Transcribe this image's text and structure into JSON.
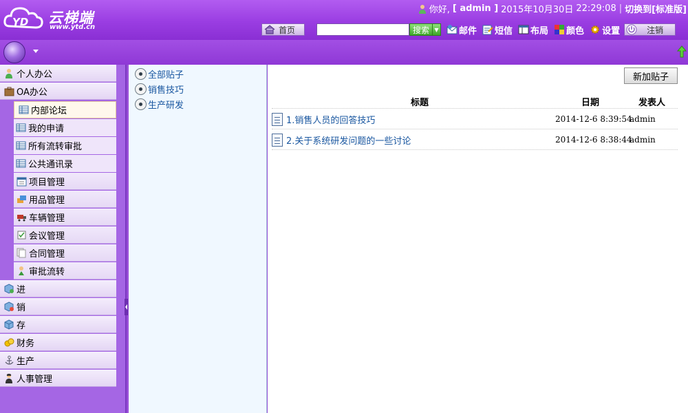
{
  "header": {
    "logo_text": "云梯端",
    "logo_url": "www.ytd.cn",
    "greeting": "你好,",
    "username": "[ admin ]",
    "date": "2015年10月30日",
    "time": "22:29:08",
    "switch_label": "切换到[标准版]"
  },
  "toolbar": {
    "home_label": "首页",
    "search_placeholder": "",
    "search_label": "搜索",
    "mail_label": "邮件",
    "sms_label": "短信",
    "layout_label": "布局",
    "color_label": "颜色",
    "settings_label": "设置",
    "logout_label": "注销"
  },
  "sidebar": {
    "items": [
      {
        "label": "个人办公",
        "icon": "person-icon"
      },
      {
        "label": "OA办公",
        "icon": "briefcase-icon"
      },
      {
        "label": "内部论坛",
        "icon": "grid-icon",
        "active": true
      },
      {
        "label": "我的申请",
        "icon": "grid-icon"
      },
      {
        "label": "所有流转审批",
        "icon": "grid-icon"
      },
      {
        "label": "公共通讯录",
        "icon": "grid-icon"
      },
      {
        "label": "项目管理",
        "icon": "calendar-icon"
      },
      {
        "label": "用品管理",
        "icon": "supplies-icon"
      },
      {
        "label": "车辆管理",
        "icon": "truck-icon"
      },
      {
        "label": "会议管理",
        "icon": "meeting-icon"
      },
      {
        "label": "合同管理",
        "icon": "pages-icon"
      },
      {
        "label": "审批流转",
        "icon": "approval-icon"
      },
      {
        "label": "进",
        "icon": "cube-in-icon"
      },
      {
        "label": "销",
        "icon": "cube-out-icon"
      },
      {
        "label": "存",
        "icon": "cube-icon"
      },
      {
        "label": "财务",
        "icon": "coins-icon"
      },
      {
        "label": "生产",
        "icon": "anchor-icon"
      },
      {
        "label": "人事管理",
        "icon": "staff-icon"
      }
    ]
  },
  "categories": [
    "全部贴子",
    "销售技巧",
    "生产研发"
  ],
  "main": {
    "new_post_label": "新加贴子",
    "columns": {
      "title": "标题",
      "date": "日期",
      "author": "发表人"
    },
    "posts": [
      {
        "title": "1.销售人员的回答技巧",
        "date": "2014-12-6 8:39:54",
        "author": "admin"
      },
      {
        "title": "2.关于系统研发问题的一些讨论",
        "date": "2014-12-6 8:38:44",
        "author": "admin"
      }
    ]
  },
  "colors": {
    "header_purple": "#9a3de2",
    "sidebar_purple": "#a566e4",
    "link_blue": "#1a57a0",
    "category_bg": "#f0f8ff"
  }
}
